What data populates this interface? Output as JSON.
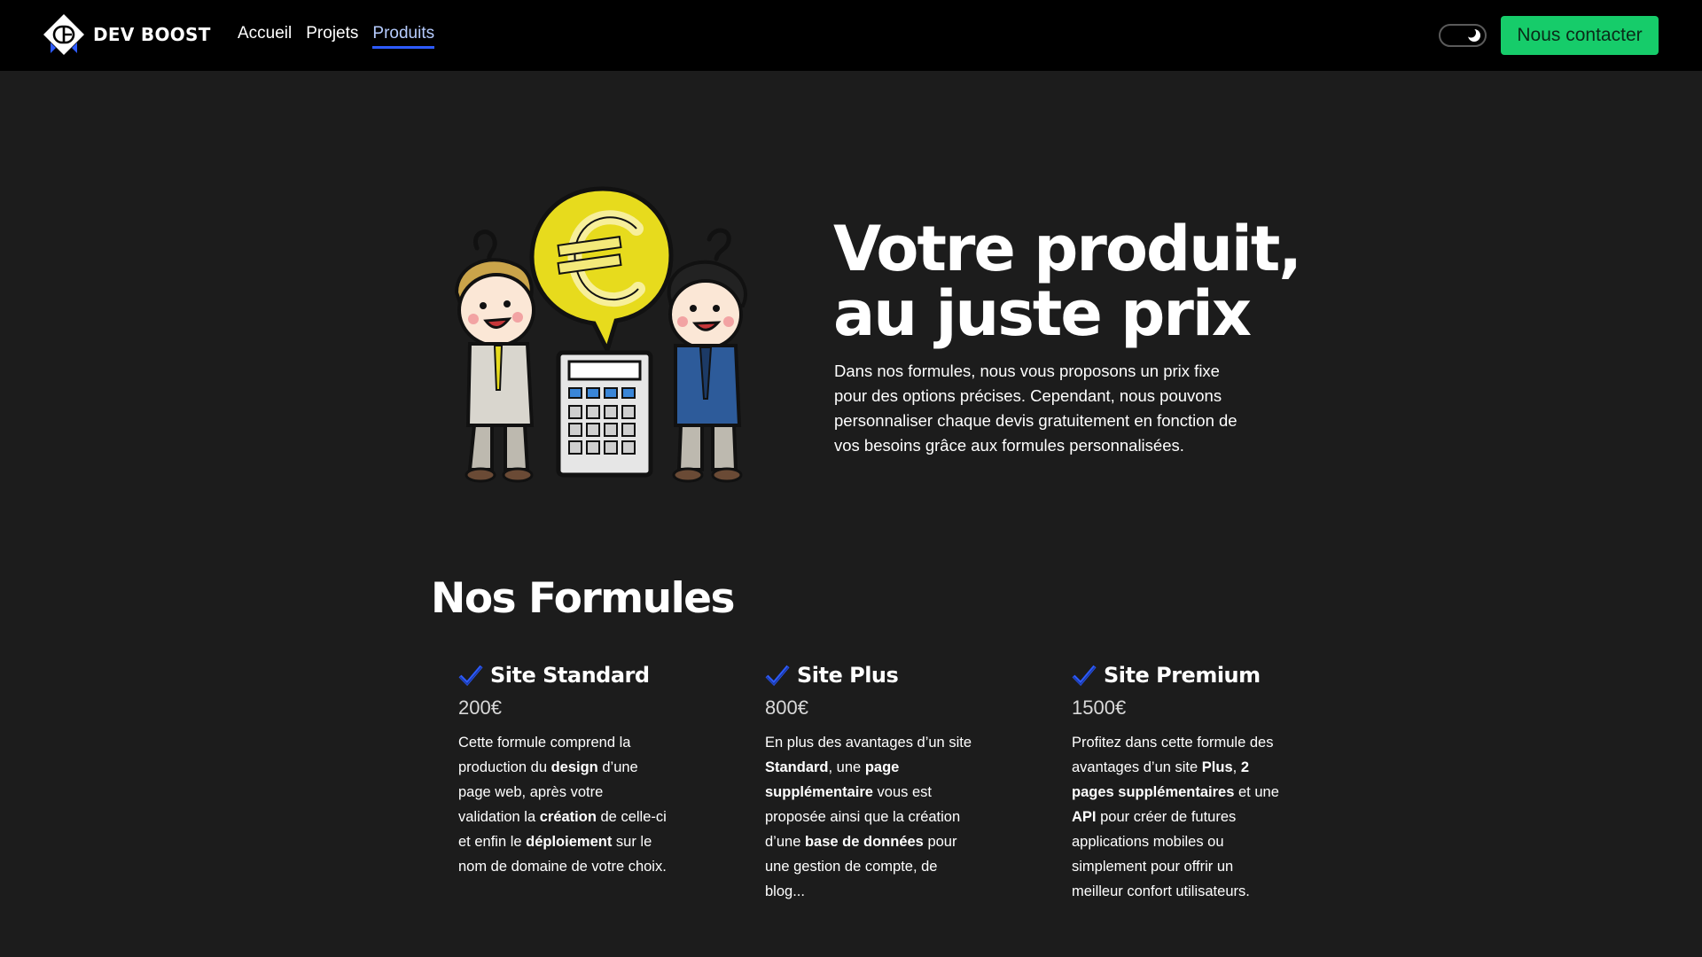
{
  "header": {
    "brand_name": "DEV BOOST",
    "logo_icon": "db-diamond-logo",
    "nav": [
      {
        "label": "Accueil",
        "active": false
      },
      {
        "label": "Projets",
        "active": false
      },
      {
        "label": "Produits",
        "active": true
      }
    ],
    "theme_toggle_icon": "moon-icon",
    "theme_toggle_state": "dark",
    "contact_button": "Nous contacter"
  },
  "hero": {
    "title_line1": "Votre produit,",
    "title_line2": "au juste prix",
    "text": "Dans nos formules, nous vous proposons un prix fixe pour des options précises. Cependant, nous pouvons personnaliser chaque devis gratuitement en fonction de vos besoins grâce aux formules personnalisées.",
    "illustration": "two-businessmen-calculator-euro-icon"
  },
  "formules": {
    "title": "Nos Formules",
    "cards": [
      {
        "title": "Site Standard",
        "price": "200€",
        "desc": [
          {
            "t": "Cette formule comprend la production du "
          },
          {
            "t": "design",
            "b": true
          },
          {
            "t": " d’une page web, après votre validation la "
          },
          {
            "t": "création",
            "b": true
          },
          {
            "t": " de celle-ci et enfin le "
          },
          {
            "t": "déploiement",
            "b": true
          },
          {
            "t": " sur le nom de domaine de votre choix."
          }
        ]
      },
      {
        "title": "Site Plus",
        "price": "800€",
        "desc": [
          {
            "t": "En plus des avantages d’un site "
          },
          {
            "t": "Standard",
            "b": true
          },
          {
            "t": ", une "
          },
          {
            "t": "page supplémentaire",
            "b": true
          },
          {
            "t": " vous est proposée ainsi que la création d’une "
          },
          {
            "t": "base de données",
            "b": true
          },
          {
            "t": " pour une gestion de compte, de blog..."
          }
        ]
      },
      {
        "title": "Site Premium",
        "price": "1500€",
        "desc": [
          {
            "t": "Profitez dans cette formule des avantages d’un site "
          },
          {
            "t": "Plus",
            "b": true
          },
          {
            "t": ", "
          },
          {
            "t": "2 pages supplémentaires",
            "b": true
          },
          {
            "t": " et une "
          },
          {
            "t": "API",
            "b": true
          },
          {
            "t": " pour créer de futures applications mobiles ou simplement pour offrir un meilleur confort utilisateurs."
          }
        ]
      }
    ]
  },
  "colors": {
    "background": "#1c1c1c",
    "header": "#000000",
    "accent_green": "#16cc6a",
    "accent_blue": "#2d5bff"
  }
}
